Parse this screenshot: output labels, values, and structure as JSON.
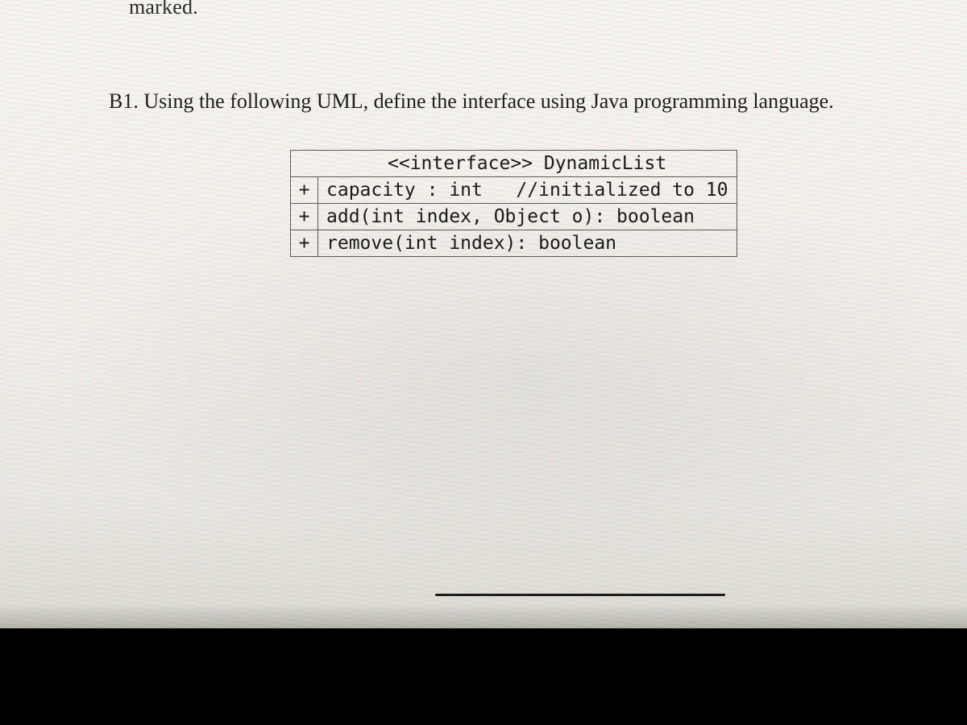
{
  "cut_word": "marked.",
  "question": {
    "number": "B1.",
    "text": "Using the following UML, define the interface using Java programming language."
  },
  "uml": {
    "header": "<<interface>> DynamicList",
    "rows": [
      {
        "vis": "+",
        "sig": "capacity : int   //initialized to 10"
      },
      {
        "vis": "+",
        "sig": "add(int index, Object o): boolean"
      },
      {
        "vis": "+",
        "sig": "remove(int index): boolean"
      }
    ]
  }
}
